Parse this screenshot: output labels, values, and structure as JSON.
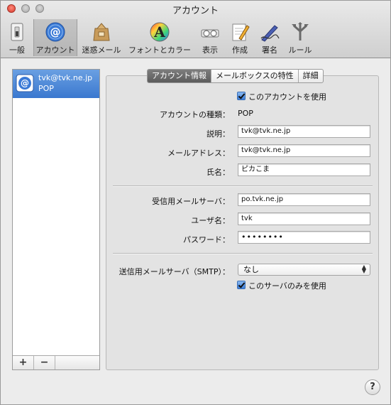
{
  "window": {
    "title": "アカウント"
  },
  "toolbar": {
    "items": [
      {
        "label": "一般",
        "icon": "switch-icon"
      },
      {
        "label": "アカウント",
        "icon": "at-sign-icon"
      },
      {
        "label": "迷惑メール",
        "icon": "junk-mail-bag-icon"
      },
      {
        "label": "フォントとカラー",
        "icon": "font-color-wheel-icon"
      },
      {
        "label": "表示",
        "icon": "glasses-icon"
      },
      {
        "label": "作成",
        "icon": "compose-pencil-icon"
      },
      {
        "label": "署名",
        "icon": "signature-pen-icon"
      },
      {
        "label": "ルール",
        "icon": "rules-arrows-icon"
      }
    ],
    "selected": "アカウント"
  },
  "sidebar": {
    "accounts": [
      {
        "name": "tvk@tvk.ne.jp",
        "type": "POP"
      }
    ],
    "add_label": "+",
    "remove_label": "−"
  },
  "tabs": [
    {
      "label": "アカウント情報"
    },
    {
      "label": "メールボックスの特性"
    },
    {
      "label": "詳細"
    }
  ],
  "form": {
    "enable_label": "このアカウントを使用",
    "enable_checked": true,
    "type_label": "アカウントの種類：",
    "type_value": "POP",
    "desc_label": "説明：",
    "desc_value": "tvk@tvk.ne.jp",
    "email_label": "メールアドレス：",
    "email_value": "tvk@tvk.ne.jp",
    "fullname_label": "氏名：",
    "fullname_value": "ピカこま",
    "incoming_label": "受信用メールサーバ：",
    "incoming_value": "po.tvk.ne.jp",
    "user_label": "ユーザ名：",
    "user_value": "tvk",
    "password_label": "パスワード：",
    "password_value": "••••••••",
    "smtp_label": "送信用メールサーバ（SMTP）：",
    "smtp_value": "なし",
    "only_server_label": "このサーバのみを使用",
    "only_server_checked": true
  },
  "help_label": "?",
  "colors": {
    "selection_blue": "#3a78cf",
    "active_tab": "#5c5c5c",
    "checkbox_blue": "#3c7cd6"
  }
}
